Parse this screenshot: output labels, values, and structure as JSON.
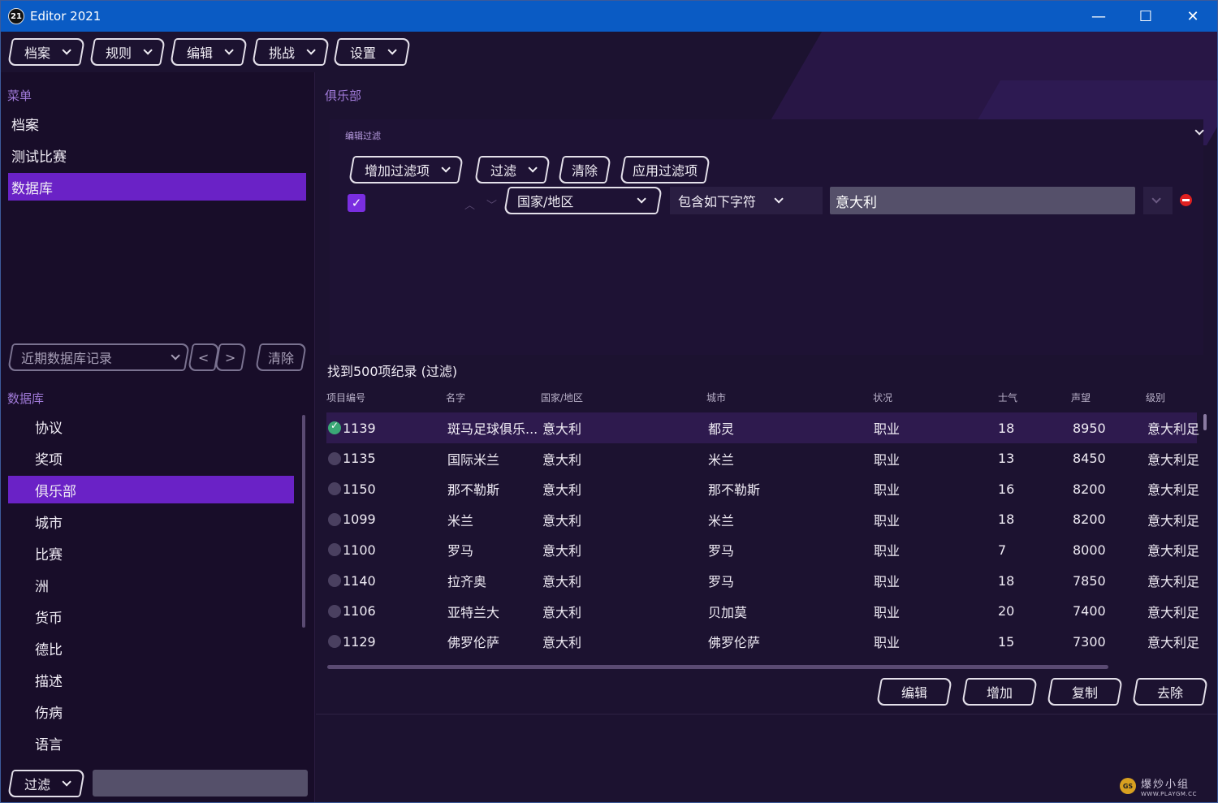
{
  "window": {
    "title": "Editor 2021",
    "app_icon": "21",
    "minimize": "—",
    "maximize": "☐",
    "close": "✕"
  },
  "menubar": [
    {
      "label": "档案"
    },
    {
      "label": "规则"
    },
    {
      "label": "编辑"
    },
    {
      "label": "挑战"
    },
    {
      "label": "设置"
    }
  ],
  "sidebar": {
    "menu_label": "菜单",
    "menu_items": [
      {
        "label": "档案"
      },
      {
        "label": "测试比赛"
      },
      {
        "label": "数据库",
        "active": true
      }
    ],
    "recent_label": "近期数据库记录",
    "prev": "<",
    "next": ">",
    "clear_label": "清除",
    "db_label": "数据库",
    "db_items": [
      {
        "label": "协议"
      },
      {
        "label": "奖项"
      },
      {
        "label": "俱乐部",
        "active": true
      },
      {
        "label": "城市"
      },
      {
        "label": "比赛"
      },
      {
        "label": "洲"
      },
      {
        "label": "货币"
      },
      {
        "label": "德比"
      },
      {
        "label": "描述"
      },
      {
        "label": "伤病"
      },
      {
        "label": "语言"
      }
    ],
    "filter_label": "过滤",
    "search_value": ""
  },
  "main": {
    "section_title": "俱乐部",
    "filter_panel": {
      "title": "编辑过滤",
      "buttons": {
        "add_filter": "增加过滤项",
        "filter": "过滤",
        "clear": "清除",
        "apply": "应用过滤项"
      },
      "rule": {
        "checked": true,
        "field": "国家/地区",
        "operator": "包含如下字符",
        "value": "意大利"
      }
    },
    "found_label": "找到500项纪录 (过滤)",
    "table": {
      "headers": [
        "项目编号",
        "名字",
        "国家/地区",
        "城市",
        "状况",
        "士气",
        "声望",
        "级别"
      ],
      "rows": [
        {
          "id": "1139",
          "name": "斑马足球俱乐...",
          "country": "意大利",
          "city": "都灵",
          "status": "职业",
          "morale": "18",
          "rep": "8950",
          "level": "意大利足",
          "selected": true
        },
        {
          "id": "1135",
          "name": "国际米兰",
          "country": "意大利",
          "city": "米兰",
          "status": "职业",
          "morale": "13",
          "rep": "8450",
          "level": "意大利足"
        },
        {
          "id": "1150",
          "name": "那不勒斯",
          "country": "意大利",
          "city": "那不勒斯",
          "status": "职业",
          "morale": "16",
          "rep": "8200",
          "level": "意大利足"
        },
        {
          "id": "1099",
          "name": "米兰",
          "country": "意大利",
          "city": "米兰",
          "status": "职业",
          "morale": "18",
          "rep": "8200",
          "level": "意大利足"
        },
        {
          "id": "1100",
          "name": "罗马",
          "country": "意大利",
          "city": "罗马",
          "status": "职业",
          "morale": "7",
          "rep": "8000",
          "level": "意大利足"
        },
        {
          "id": "1140",
          "name": "拉齐奥",
          "country": "意大利",
          "city": "罗马",
          "status": "职业",
          "morale": "18",
          "rep": "7850",
          "level": "意大利足"
        },
        {
          "id": "1106",
          "name": "亚特兰大",
          "country": "意大利",
          "city": "贝加莫",
          "status": "职业",
          "morale": "20",
          "rep": "7400",
          "level": "意大利足"
        },
        {
          "id": "1129",
          "name": "佛罗伦萨",
          "country": "意大利",
          "city": "佛罗伦萨",
          "status": "职业",
          "morale": "15",
          "rep": "7300",
          "level": "意大利足"
        }
      ]
    },
    "actions": {
      "edit": "编辑",
      "add": "增加",
      "copy": "复制",
      "remove": "去除"
    }
  },
  "watermark": {
    "logo": "GS",
    "line1": "爆炒小组",
    "line2": "WWW.PLAYGM.CC"
  }
}
